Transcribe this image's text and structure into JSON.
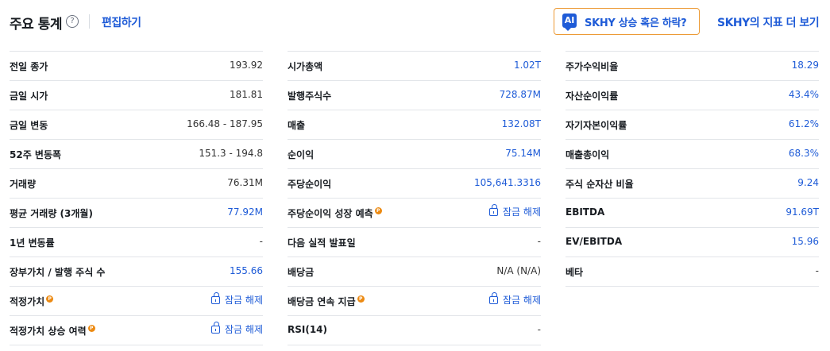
{
  "header": {
    "title": "주요 통계",
    "help_glyph": "?",
    "edit_label": "편집하기",
    "ai_icon_text": "AI",
    "ai_button_label": "SKHY 상승 혹은 하락?",
    "more_link": "SKHY의 지표 더 보기"
  },
  "unlock_label": "잠금 해제",
  "pro_glyph": "P",
  "columns": [
    {
      "rows": [
        {
          "label": "전일 종가",
          "value": "193.92"
        },
        {
          "label": "금일 시가",
          "value": "181.81"
        },
        {
          "label": "금일 변동",
          "value": "166.48 - 187.95"
        },
        {
          "label": "52주 변동폭",
          "value": "151.3 - 194.8"
        },
        {
          "label": "거래량",
          "value": "76.31M"
        },
        {
          "label": "평균 거래량 (3개월)",
          "value": "77.92M"
        },
        {
          "label": "1년 변동률",
          "value": "-"
        },
        {
          "label": "장부가치 / 발행 주식 수",
          "value": "155.66"
        },
        {
          "label": "적정가치",
          "value": ""
        },
        {
          "label": "적정가치 상승 여력",
          "value": ""
        }
      ]
    },
    {
      "rows": [
        {
          "label": "시가총액",
          "value": "1.02T"
        },
        {
          "label": "발행주식수",
          "value": "728.87M"
        },
        {
          "label": "매출",
          "value": "132.08T"
        },
        {
          "label": "순이익",
          "value": "75.14M"
        },
        {
          "label": "주당순이익",
          "value": "105,641.3316"
        },
        {
          "label": "주당순이익 성장 예측",
          "value": ""
        },
        {
          "label": "다음 실적 발표일",
          "value": "-"
        },
        {
          "label": "배당금",
          "value": "N/A (N/A)"
        },
        {
          "label": "배당금 연속 지급",
          "value": ""
        },
        {
          "label": "RSI(14)",
          "value": "-"
        }
      ]
    },
    {
      "rows": [
        {
          "label": "주가수익비율",
          "value": "18.29"
        },
        {
          "label": "자산순이익률",
          "value": "43.4%"
        },
        {
          "label": "자기자본이익률",
          "value": "61.2%"
        },
        {
          "label": "매출총이익",
          "value": "68.3%"
        },
        {
          "label": "주식 순자산 비율",
          "value": "9.24"
        },
        {
          "label": "EBITDA",
          "value": "91.69T"
        },
        {
          "label": "EV/EBITDA",
          "value": "15.96"
        },
        {
          "label": "베타",
          "value": "-"
        }
      ]
    }
  ]
}
